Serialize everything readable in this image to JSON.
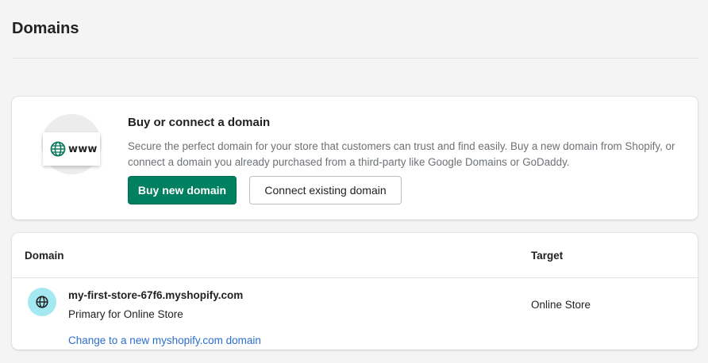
{
  "page": {
    "title": "Domains"
  },
  "promo": {
    "illustration_text": "www",
    "heading": "Buy or connect a domain",
    "description": "Secure the perfect domain for your store that customers can trust and find easily. Buy a new domain from Shopify, or connect a domain you already purchased from a third-party like Google Domains or GoDaddy.",
    "buy_button": "Buy new domain",
    "connect_button": "Connect existing domain"
  },
  "table": {
    "headers": {
      "domain": "Domain",
      "target": "Target"
    },
    "rows": [
      {
        "domain": "my-first-store-67f6.myshopify.com",
        "subtitle": "Primary for Online Store",
        "link": "Change to a new myshopify.com domain",
        "target": "Online Store",
        "icon": "globe-icon"
      }
    ]
  },
  "colors": {
    "primary": "#008060",
    "link": "#2c6ecb",
    "avatar_bg": "#a4e8f2",
    "page_bg": "#f4f4f4"
  }
}
